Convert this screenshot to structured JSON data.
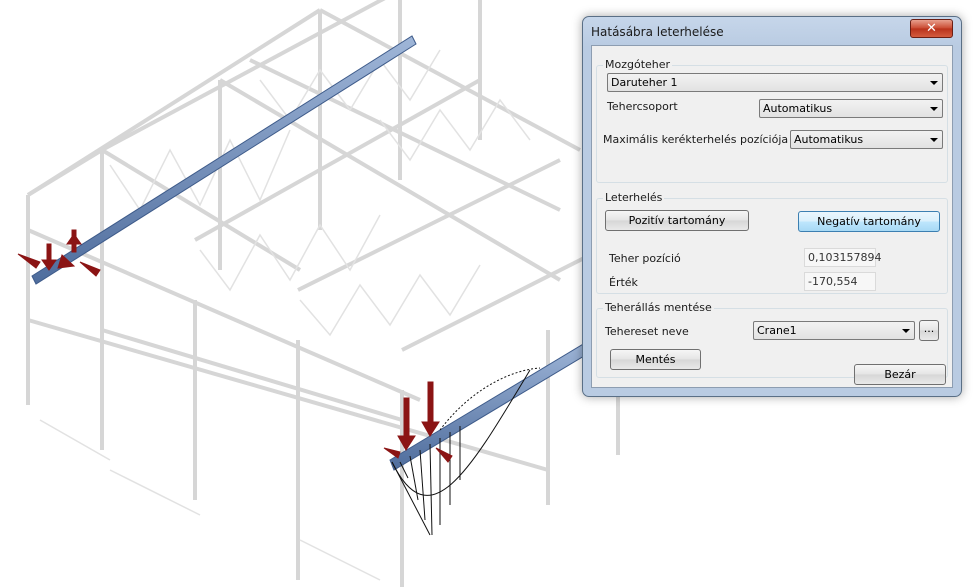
{
  "dialog": {
    "title": "Hatásábra leterhelése",
    "close_label": "✕",
    "mozgoteher": {
      "group_title": "Mozgóteher",
      "load_select": "Daruteher 1",
      "tehercsoport_label": "Tehercsoport",
      "tehercsoport_value": "Automatikus",
      "maxpos_label": "Maximális kerékterhelés pozíciója",
      "maxpos_value": "Automatikus"
    },
    "leterheles": {
      "group_title": "Leterhelés",
      "positive_btn": "Pozitív tartomány",
      "negative_btn": "Negatív tartomány",
      "pos_label": "Teher pozíció",
      "pos_value": "0,103157894",
      "value_label": "Érték",
      "value_value": "-170,554"
    },
    "mentes": {
      "group_title": "Teherállás mentése",
      "name_label": "Tehereset neve",
      "name_value": "Crane1",
      "browse_btn": "...",
      "save_btn": "Mentés"
    },
    "close_btn": "Bezár"
  }
}
